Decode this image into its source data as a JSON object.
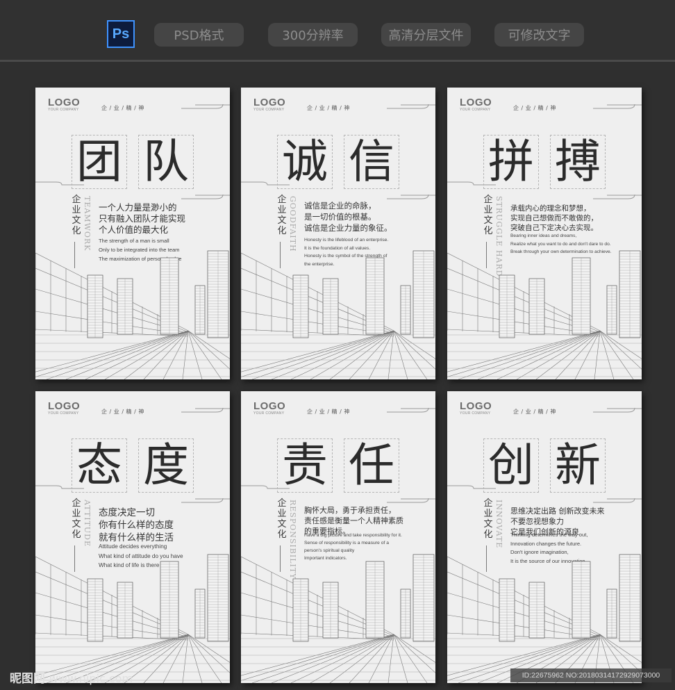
{
  "header": {
    "app_icon": "Ps",
    "tags": [
      "PSD格式",
      "300分辨率",
      "高清分层文件",
      "可修改文字"
    ]
  },
  "posters": [
    {
      "logo": "LOGO",
      "logo_sub": "YOUR COMPANY",
      "motto": "企 / 业 / 精 / 神",
      "chars": [
        "团",
        "队"
      ],
      "vertical_label": "企业文化",
      "english_vertical": "TEAMWORK",
      "zh_lines": [
        "一个人力量是渺小的",
        "只有融入团队才能实现",
        "个人价值的最大化"
      ],
      "en_lines": [
        "The strength of a man is small",
        "Only to be integrated into the team",
        "The maximization of personal value"
      ]
    },
    {
      "logo": "LOGO",
      "logo_sub": "YOUR COMPANY",
      "motto": "企 / 业 / 精 / 神",
      "chars": [
        "诚",
        "信"
      ],
      "vertical_label": "企业文化",
      "english_vertical": "GOODFAITH",
      "zh_lines": [
        "诚信是企业的命脉，",
        "是一切价值的根基。",
        "诚信是企业力量的象征。"
      ],
      "en_lines": [
        "Honesty is the lifeblood of an enterprise.",
        "It is the foundation of all values.",
        "Honesty is the symbol of the strength of",
        "the enterprise."
      ]
    },
    {
      "logo": "LOGO",
      "logo_sub": "YOUR COMPANY",
      "motto": "企 / 业 / 精 / 神",
      "chars": [
        "拼",
        "搏"
      ],
      "vertical_label": "企业文化",
      "english_vertical": "STRUGGLE HARD",
      "zh_lines": [
        "承载内心的理念和梦想，",
        "实现自己想做而不敢做的，",
        "突破自己下定决心去实现。"
      ],
      "en_lines": [
        "Bearing inner ideas and dreams,",
        "Realize what you want to do and don't dare to do.",
        "Break through your own determination to achieve."
      ]
    },
    {
      "logo": "LOGO",
      "logo_sub": "YOUR COMPANY",
      "motto": "企 / 业 / 精 / 神",
      "chars": [
        "态",
        "度"
      ],
      "vertical_label": "企业文化",
      "english_vertical": "ATTITUDE",
      "zh_lines": [
        "态度决定一切",
        "你有什么样的态度",
        "就有什么样的生活"
      ],
      "en_lines": [
        "Attitude decides everything",
        "What kind of attitude do you have",
        "What kind of life is there"
      ]
    },
    {
      "logo": "LOGO",
      "logo_sub": "YOUR COMPANY",
      "motto": "企 / 业 / 精 / 神",
      "chars": [
        "责",
        "任"
      ],
      "vertical_label": "企业文化",
      "english_vertical": "RESPONSIBILITY",
      "zh_lines": [
        "胸怀大局，勇于承担责任，",
        "责任感是衡量一个人精神素质",
        "的重要指标。"
      ],
      "en_lines": [
        "Have a big picture and take responsibility for it.",
        "Sense of responsibility is a measure of a",
        "person's spiritual quality",
        "Important indicators."
      ]
    },
    {
      "logo": "LOGO",
      "logo_sub": "YOUR COMPANY",
      "motto": "企 / 业 / 精 / 神",
      "chars": [
        "创",
        "新"
      ],
      "vertical_label": "企业文化",
      "english_vertical": "INNOVATE",
      "zh_lines": [
        "思维决定出路  创新改变未来",
        "不要忽视想象力",
        "它是我们创新的源泉"
      ],
      "en_lines": [
        "Thinking determines the way out,",
        "Innovation changes the future.",
        "Don't ignore imagination,",
        "It is the source of our innovation."
      ]
    }
  ],
  "watermark": {
    "left_brand": "昵图网",
    "left_url": "www.nipic.com",
    "right": "ID:22675962 NO:20180314172929073000"
  }
}
